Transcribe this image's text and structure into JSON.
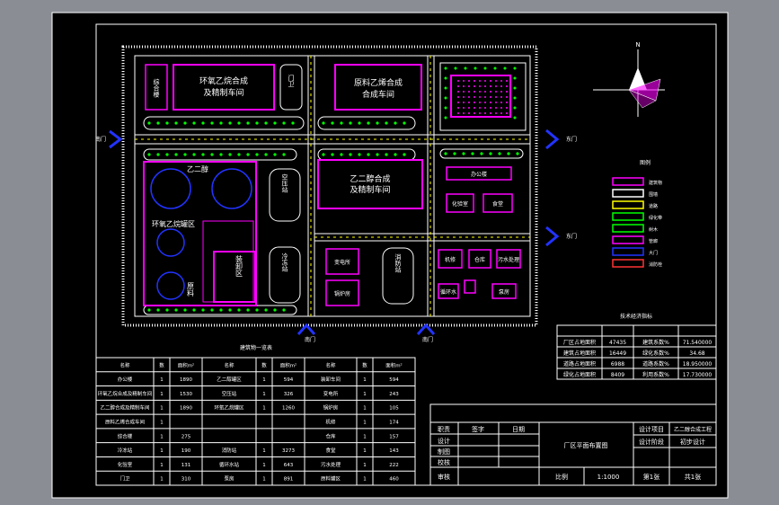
{
  "colors": {
    "background_outer": "#8a8d94",
    "drawing_bg": "#000000",
    "line": "#ffffff",
    "building": "#ff00ff",
    "road_mark": "#ffff00",
    "tree": "#00ff00",
    "gate_arrow": "#2233ff",
    "tank": "#2233ff",
    "red_mark": "#ff3333",
    "text": "#ffffff"
  },
  "buildings": {
    "b1": "环氧乙烷合成",
    "b1b": "及精制车间",
    "b2": "原料乙烯合成",
    "b2b": "合成车间",
    "b3": "乙二醇合成",
    "b3b": "及精制车间",
    "tankfarm": "乙二醇",
    "tankfarm2": "环氧乙烷罐区",
    "tankfarm3": "原料",
    "storage": "装卸区",
    "small_left": "综合楼",
    "small_v1": "门卫",
    "mid_v1": "空压站",
    "mid_v2": "冷冻站",
    "mid_v3": "消防站",
    "office": "办公楼",
    "lab": "化验室",
    "canteen": "食堂",
    "r1": "变电所",
    "r2": "锅炉房",
    "r3": "机修",
    "r4": "仓库",
    "r5": "污水处理",
    "r6": "循环水",
    "r7": "泵房"
  },
  "gates": {
    "left": "南门",
    "right_top": "东门",
    "bottom_left": "南门",
    "bottom_right": "南门"
  },
  "legend": {
    "title": "图例",
    "items": [
      "建筑物",
      "围墙",
      "道路",
      "绿化带",
      "树木",
      "管廊",
      "大门",
      "消防栓"
    ]
  },
  "tech_table": {
    "title": "技术经济指标",
    "rows": [
      [
        "厂区占地面积",
        "47435",
        "建筑系数%",
        "71.540000"
      ],
      [
        "建筑占地面积",
        "16449",
        "绿化系数%",
        "34.68"
      ],
      [
        "道路占地面积",
        "6988",
        "道路系数%",
        "18.950000"
      ],
      [
        "绿化占地面积",
        "8409",
        "利用系数%",
        "17.730000"
      ]
    ]
  },
  "bldg_table": {
    "title": "建筑物一览表",
    "header": [
      "名称",
      "数",
      "面积m²",
      "名称",
      "数",
      "面积m²",
      "名称",
      "数",
      "面积m²"
    ],
    "rows": [
      [
        "办公楼",
        "1",
        "1890",
        "乙二醇罐区",
        "1",
        "594",
        "装卸车间",
        "1",
        "594"
      ],
      [
        "环氧乙烷合成及精制车间",
        "1",
        "1530",
        "空压站",
        "1",
        "326",
        "变电所",
        "1",
        "243"
      ],
      [
        "乙二醇合成及精制车间",
        "1",
        "1890",
        "环氧乙烷罐区",
        "1",
        "1260",
        "锅炉房",
        "1",
        "105"
      ],
      [
        "原料乙烯合成车间",
        "1",
        "",
        "",
        "",
        "",
        "机修",
        "1",
        "174"
      ],
      [
        "综合楼",
        "1",
        "275",
        "",
        "",
        "",
        "仓库",
        "1",
        "157"
      ],
      [
        "冷冻站",
        "1",
        "190",
        "消防站",
        "1",
        "3273",
        "食堂",
        "1",
        "143"
      ],
      [
        "化验室",
        "1",
        "131",
        "循环水站",
        "1",
        "643",
        "污水处理",
        "1",
        "222"
      ],
      [
        "门卫",
        "1",
        "310",
        "泵房",
        "1",
        "891",
        "原料罐区",
        "1",
        "460"
      ]
    ]
  },
  "title_block": {
    "r1": [
      "职责",
      "签字",
      "日期"
    ],
    "r2": "设计",
    "r3": "制图",
    "r4": "校核",
    "r5": "审核",
    "drawing_title": "厂区平面布置图",
    "project_label": "设计项目",
    "project_value": "乙二醇合成工程",
    "stage_label": "设计阶段",
    "stage_value": "初步设计",
    "scale_label": "比例",
    "scale_value": "1:1000",
    "sheet_label": "第1张",
    "sheet_total": "共1张"
  },
  "compass_label": "N"
}
